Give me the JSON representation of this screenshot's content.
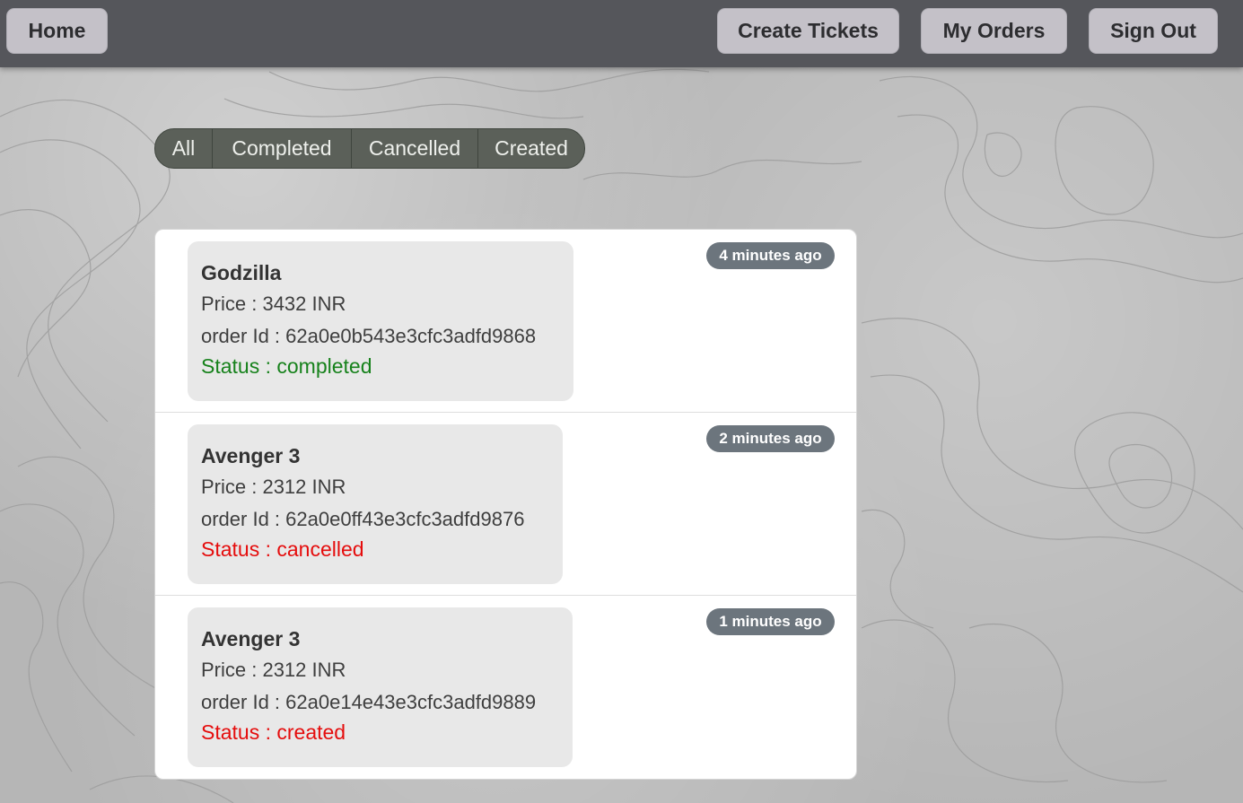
{
  "nav": {
    "home_label": "Home",
    "create_label": "Create Tickets",
    "orders_label": "My Orders",
    "signout_label": "Sign Out"
  },
  "filters": {
    "items": [
      "All",
      "Completed",
      "Cancelled",
      "Created"
    ]
  },
  "orders": [
    {
      "title": "Godzilla",
      "price": "Price : 3432 INR",
      "order_id": "order Id : 62a0e0b543e3cfc3adfd9868",
      "status": "Status : completed",
      "time": "4 minutes ago"
    },
    {
      "title": "Avenger 3",
      "price": "Price : 2312 INR",
      "order_id": "order Id : 62a0e0ff43e3cfc3adfd9876",
      "status": "Status : cancelled",
      "time": "2 minutes ago"
    },
    {
      "title": "Avenger 3",
      "price": "Price : 2312 INR",
      "order_id": "order Id : 62a0e14e43e3cfc3adfd9889",
      "status": "Status : created",
      "time": "1 minutes ago"
    }
  ],
  "colors": {
    "topbar": "#55565b",
    "nav_button": "#c4c1c8",
    "filter_bar": "#5b6059",
    "badge": "#6c757d",
    "status_completed": "#17821c",
    "status_cancelled": "#e50d0d",
    "status_created": "#e50d0d"
  }
}
